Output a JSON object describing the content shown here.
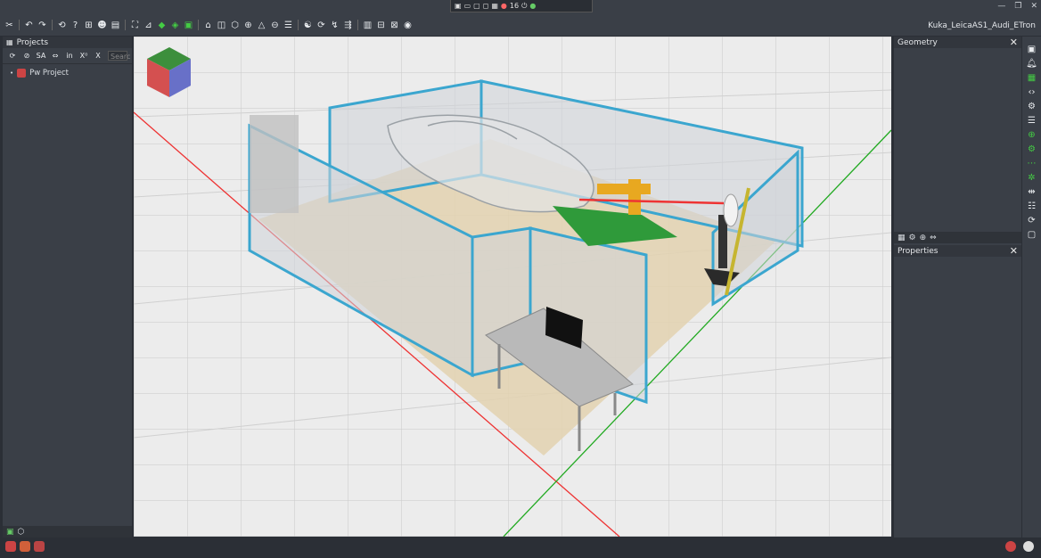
{
  "window": {
    "document_title": "Kuka_LeicaAS1_Audi_ETron",
    "fps": "16"
  },
  "colors": {
    "chrome": "#3a3f47",
    "viewport_bg": "#eeeeee",
    "fence": "#3ba6cf",
    "floor": "#e3d2b0",
    "axis_x": "#e33",
    "axis_y": "#2a2"
  },
  "toolbar": {
    "icons": [
      "tools-icon",
      "undo-icon",
      "redo-icon",
      "history-icon",
      "help-icon",
      "hierarchy-icon",
      "user-icon",
      "save-icon",
      "fit-view-icon",
      "snap-icon",
      "move-icon",
      "frame-icon",
      "box-icon",
      "cube-icon",
      "sphere-icon",
      "cone-icon",
      "cylinder-icon",
      "collision-icon",
      "kinematics-icon",
      "measure-icon",
      "layer-icon",
      "visibility-icon"
    ]
  },
  "left_panel": {
    "title": "Projects",
    "tools": [
      "sync-icon",
      "link-icon",
      "SA",
      "swap-icon",
      "in",
      "X⁰",
      "X"
    ],
    "search_placeholder": "Searc",
    "tree": [
      {
        "label": "Pw Project"
      }
    ]
  },
  "right_panel": {
    "geometry_title": "Geometry",
    "properties_title": "Properties"
  }
}
